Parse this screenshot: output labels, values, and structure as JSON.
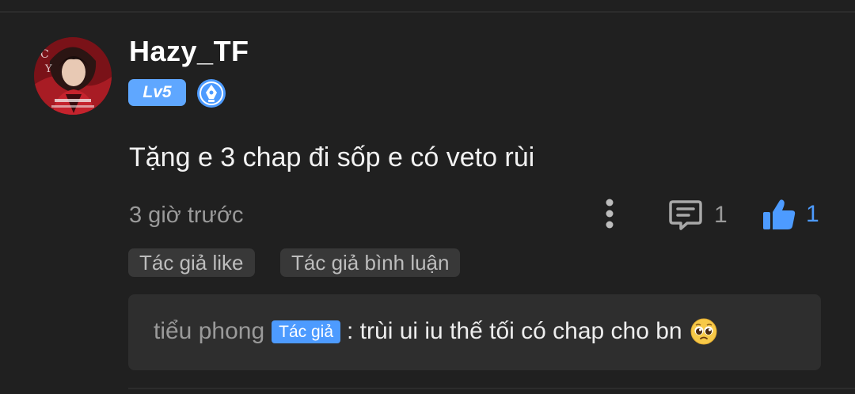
{
  "user": {
    "name": "Hazy_TF",
    "level": "Lv5",
    "badge_icon": "pen-nib-badge-icon",
    "avatar_icon": "user-avatar"
  },
  "comment": {
    "text": "Tặng e 3 chap đi sốp e có veto rùi",
    "time": "3 giờ trước"
  },
  "actions": {
    "more_icon": "more-vertical-icon",
    "reply_icon": "comment-icon",
    "reply_count": "1",
    "like_icon": "thumbs-up-icon",
    "like_count": "1"
  },
  "tags": [
    {
      "label": "Tác giả like"
    },
    {
      "label": "Tác giả bình luận"
    }
  ],
  "reply": {
    "author": "tiểu phong",
    "author_badge": "Tác giả",
    "text": ": trùi ui iu thế tối có chap cho bn",
    "emoji": "pleading-face"
  },
  "colors": {
    "background": "#202020",
    "accent_blue": "#4d9bff",
    "level_badge": "#5fa7ff",
    "muted_text": "#9a9a9a",
    "tag_bg": "#383838",
    "reply_bg": "#2e2e2e"
  }
}
